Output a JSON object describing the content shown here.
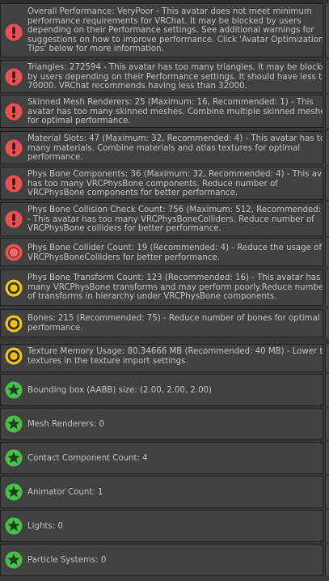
{
  "colors": {
    "error": "#ea5252",
    "warning": "#f0c419",
    "ok": "#48c04a",
    "panel": "#414141",
    "background": "#383838"
  },
  "messages": [
    {
      "severity": "error",
      "icon": "error-exclamation-icon",
      "text": "Overall Performance: VeryPoor - This avatar does not meet minimum\nperformance requirements for VRChat. It may be blocked by users\ndepending on their Performance settings. See additional warnings for\nsuggestions on how to improve performance. Click 'Avatar Optimization\nTips' below for more information."
    },
    {
      "severity": "error",
      "icon": "error-exclamation-icon",
      "text": "Triangles: 272594 - This avatar has too many triangles. It may be blocked\nby users depending on their Performance settings. It should have less than\n70000. VRChat recommends having less than 32000."
    },
    {
      "severity": "error",
      "icon": "error-exclamation-icon",
      "text": "Skinned Mesh Renderers: 25 (Maximum: 16, Recommended: 1) - This\navatar has too many skinned meshes. Combine multiple skinned meshes\nfor optimal performance."
    },
    {
      "severity": "error",
      "icon": "error-exclamation-icon",
      "text": "Material Slots: 47 (Maximum: 32, Recommended: 4) - This avatar has too\nmany materials. Combine materials and atlas textures for optimal\nperformance."
    },
    {
      "severity": "error",
      "icon": "error-exclamation-icon",
      "text": "Phys Bone Components: 36 (Maximum: 32, Recommended: 4) - This avatar\nhas too many VRCPhysBone components. Reduce number of\nVRCPhysBone components for better performance."
    },
    {
      "severity": "error",
      "icon": "error-exclamation-icon",
      "text": "Phys Bone Collision Check Count: 756 (Maximum: 512, Recommended: 32)\n- This avatar has too many VRCPhysBoneColliders. Reduce number of\nVRCPhysBone colliders for better performance."
    },
    {
      "severity": "error-dot",
      "icon": "error-circle-icon",
      "text": "Phys Bone Collider Count: 19 (Recommended: 4) - Reduce the usage of\nVRCPhysBoneColliders for better performance."
    },
    {
      "severity": "warning",
      "icon": "warning-circle-icon",
      "text": "Phys Bone Transform Count: 123 (Recommended: 16) - This avatar has\nmany VRCPhysBone transforms and may perform poorly.Reduce number\nof transforms in hierarchy under VRCPhysBone components."
    },
    {
      "severity": "warning",
      "icon": "warning-circle-icon",
      "text": "Bones: 215 (Recommended: 75) - Reduce number of bones for optimal\nperformance."
    },
    {
      "severity": "warning",
      "icon": "warning-circle-icon",
      "text": "Texture Memory Usage: 80.34666 MB (Recommended: 40 MB) - Lower the re\ntextures in the texture import settings."
    },
    {
      "severity": "ok",
      "icon": "star-ok-icon",
      "text": "Bounding box (AABB) size: (2.00, 2.00, 2.00)"
    },
    {
      "severity": "ok",
      "icon": "star-ok-icon",
      "text": "Mesh Renderers: 0"
    },
    {
      "severity": "ok",
      "icon": "star-ok-icon",
      "text": "Contact Component Count: 4"
    },
    {
      "severity": "ok",
      "icon": "star-ok-icon",
      "text": "Animator Count: 1"
    },
    {
      "severity": "ok",
      "icon": "star-ok-icon",
      "text": "Lights: 0"
    },
    {
      "severity": "ok",
      "icon": "star-ok-icon",
      "text": "Particle Systems: 0"
    }
  ]
}
